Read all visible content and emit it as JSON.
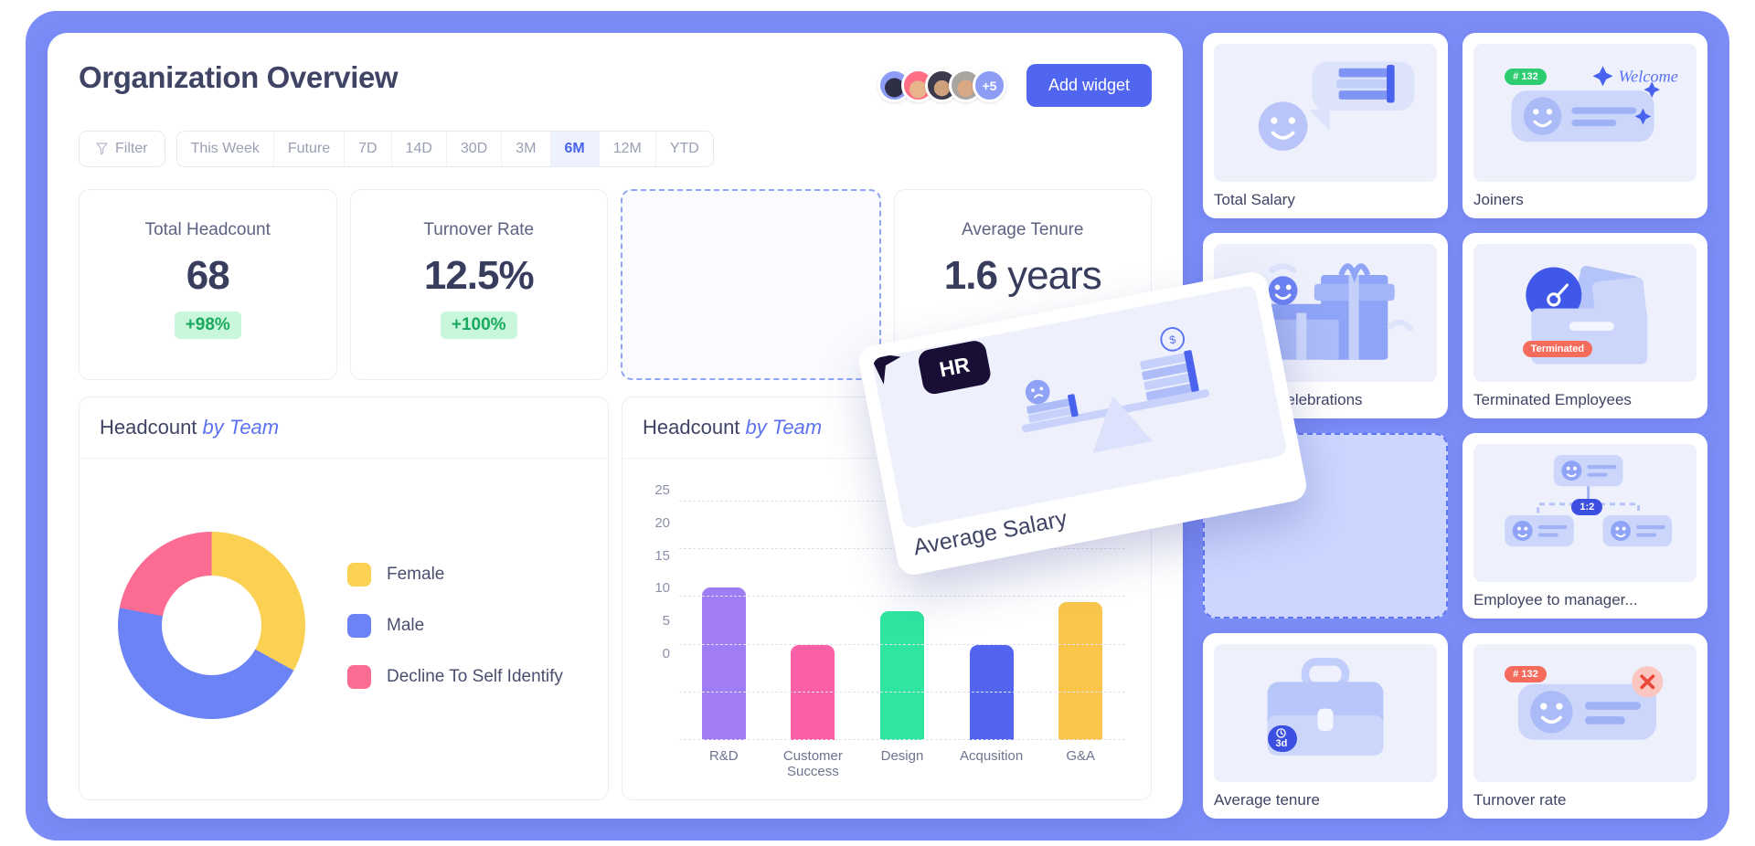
{
  "header": {
    "title": "Organization Overview",
    "avatar_overflow": "+5",
    "add_widget_label": "Add widget"
  },
  "filters": {
    "filter_label": "Filter",
    "ranges": [
      {
        "label": "This Week",
        "active": false
      },
      {
        "label": "Future",
        "active": false
      },
      {
        "label": "7D",
        "active": false
      },
      {
        "label": "14D",
        "active": false
      },
      {
        "label": "30D",
        "active": false
      },
      {
        "label": "3M",
        "active": false
      },
      {
        "label": "6M",
        "active": true
      },
      {
        "label": "12M",
        "active": false
      },
      {
        "label": "YTD",
        "active": false
      }
    ]
  },
  "kpis": [
    {
      "label": "Total Headcount",
      "value": "68",
      "unit": "",
      "delta": "+98%"
    },
    {
      "label": "Turnover Rate",
      "value": "12.5%",
      "unit": "",
      "delta": "+100%"
    },
    {
      "label": "",
      "value": "",
      "unit": "",
      "delta": ""
    },
    {
      "label": "Average Tenure",
      "value": "1.6",
      "unit": " years",
      "delta": ""
    }
  ],
  "donut_panel": {
    "title_main": "Headcount",
    "title_accent": "by Team"
  },
  "bar_panel": {
    "title_main": "Headcount",
    "title_accent": "by Team"
  },
  "chart_data": [
    {
      "type": "pie",
      "title": "Headcount by Team",
      "legend_position": "right",
      "categories": [
        "Female",
        "Male",
        "Decline To Self Identify"
      ],
      "values": [
        33,
        45,
        22
      ],
      "colors": [
        "#fbd154",
        "#6c83f5",
        "#fb6b92"
      ]
    },
    {
      "type": "bar",
      "title": "Headcount by Team",
      "xlabel": "",
      "ylabel": "",
      "grid": true,
      "ylim": [
        0,
        27
      ],
      "yticks": [
        0,
        5,
        10,
        15,
        20,
        25
      ],
      "categories": [
        "R&D",
        "Customer Success",
        "Design",
        "Acqusition",
        "G&A"
      ],
      "values": [
        16,
        10,
        13.5,
        10,
        14.5
      ],
      "colors": [
        "#a07df5",
        "#fb5fa5",
        "#2ee6a0",
        "#5264f0",
        "#f9c councils"
      ]
    }
  ],
  "drag_card": {
    "title": "Average Salary",
    "cursor_label": "HR"
  },
  "widgets": [
    {
      "title": "Total Salary",
      "icon": "chat-coins-icon",
      "badge": "",
      "badge_color": "",
      "dropzone": false
    },
    {
      "title": "Joiners",
      "icon": "welcome-card-icon",
      "badge": "# 132",
      "badge_color": "green",
      "dropzone": false
    },
    {
      "title": "Birthday Celebrations",
      "icon": "gift-boxes-icon",
      "badge": "",
      "badge_color": "",
      "dropzone": false
    },
    {
      "title": "Terminated Employees",
      "icon": "folder-exit-icon",
      "badge": "Terminated",
      "badge_color": "red",
      "dropzone": false
    },
    {
      "title": "",
      "icon": "",
      "badge": "",
      "badge_color": "",
      "dropzone": true
    },
    {
      "title": "Employee to manager...",
      "icon": "org-chart-icon",
      "badge": "1:2",
      "badge_color": "blue",
      "dropzone": false
    },
    {
      "title": "Average tenure",
      "icon": "briefcase-icon",
      "badge": "3d",
      "badge_color": "blue",
      "dropzone": false
    },
    {
      "title": "Turnover rate",
      "icon": "profile-close-icon",
      "badge": "# 132",
      "badge_color": "red",
      "dropzone": false
    }
  ],
  "colors": {
    "frame": "#7b8cf7",
    "accent": "#5065f0",
    "positive": "#1aa95f",
    "title": "#3f4464"
  }
}
